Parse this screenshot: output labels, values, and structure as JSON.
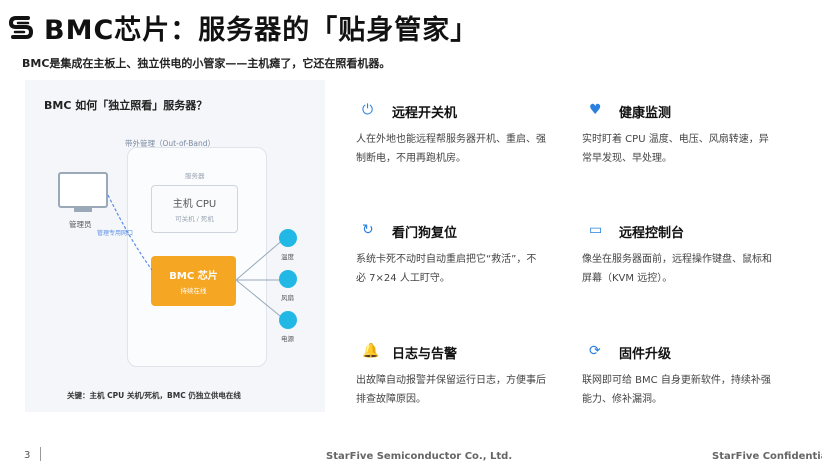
{
  "colors": {
    "accent": "#2a7fe0",
    "bmc": "#f5a623",
    "sensor": "#22b8e6"
  },
  "header": {
    "logo_icon": "starfive-s-logo",
    "title": "BMC芯片：服务器的「贴身管家」",
    "subtitle": "BMC是集成在主板上、独立供电的小管家——主机瘫了，它还在照看机器。"
  },
  "diagram": {
    "title": "BMC 如何「独立照看」服务器？",
    "oob_label": "带外管理（Out-of-Band）",
    "server_label": "服务器",
    "cpu_title": "主机 CPU",
    "cpu_sub": "可关机 / 死机",
    "bmc_title": "BMC 芯片",
    "bmc_sub": "持续在线",
    "admin_label": "管理员",
    "net_label": "管理专用网口",
    "sensors": [
      "温度",
      "风扇",
      "电源"
    ],
    "note": "关键：主机 CPU 关机/死机，BMC 仍独立供电在线"
  },
  "features": [
    {
      "icon": "power-icon",
      "glyph": "⏻",
      "title": "远程开关机",
      "desc": "人在外地也能远程帮服务器开机、重启、强制断电，不用再跑机房。"
    },
    {
      "icon": "heart-pulse-icon",
      "glyph": "♥",
      "title": "健康监测",
      "desc": "实时盯着 CPU 温度、电压、风扇转速，异常早发现、早处理。"
    },
    {
      "icon": "restart-icon",
      "glyph": "↻",
      "title": "看门狗复位",
      "desc": "系统卡死不动时自动重启把它“救活”，不必 7×24 人工盯守。"
    },
    {
      "icon": "monitor-icon",
      "glyph": "▭",
      "title": "远程控制台",
      "desc": "像坐在服务器面前，远程操作键盘、鼠标和屏幕（KVM 远控）。"
    },
    {
      "icon": "bell-icon",
      "glyph": "🔔",
      "title": "日志与告警",
      "desc": "出故障自动报警并保留运行日志，方便事后排查故障原因。"
    },
    {
      "icon": "refresh-icon",
      "glyph": "⟳",
      "title": "固件升级",
      "desc": "联网即可给 BMC 自身更新软件，持续补强能力、修补漏洞。"
    }
  ],
  "footer": {
    "page": "3",
    "company": "StarFive Semiconductor Co., Ltd.",
    "confidential": "StarFive Confidential"
  }
}
